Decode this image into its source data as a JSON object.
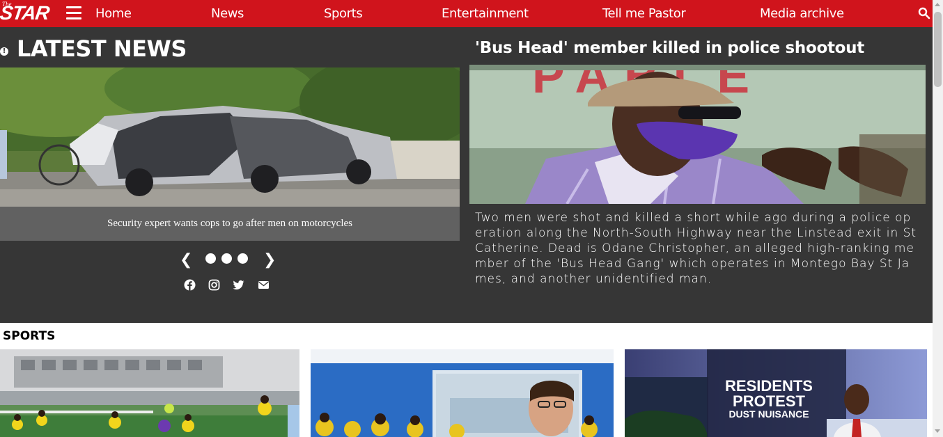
{
  "nav": {
    "logo_small": "The",
    "logo_main": "STAR",
    "links": [
      "Home",
      "News",
      "Sports",
      "Entertainment",
      "Tell me Pastor",
      "Media archive"
    ]
  },
  "latest": {
    "heading": "LATEST NEWS",
    "slide_caption": "Security expert wants cops to go after men on motorcycles",
    "featured_title": "'Bus Head' member killed in police shootout",
    "featured_body": "Two men were shot and killed a short while ago during a police operation along the North-South Highway near the Linstead exit in St Catherine. Dead is Odane Christopher, an alleged high-ranking member of the 'Bus Head Gang' which operates in Montego Bay St James, and another unidentified man.",
    "featured_sign_text": "PABLE",
    "carousel_prev": "❮",
    "carousel_next": "❯"
  },
  "sports": {
    "heading": "SPORTS",
    "card3_overlay": [
      "RESIDENTS",
      "PROTEST",
      "DUST NUISANCE"
    ]
  },
  "colors": {
    "nav_red": "#d0141c",
    "dark_bg": "#363636",
    "caption_bg": "#616161"
  }
}
